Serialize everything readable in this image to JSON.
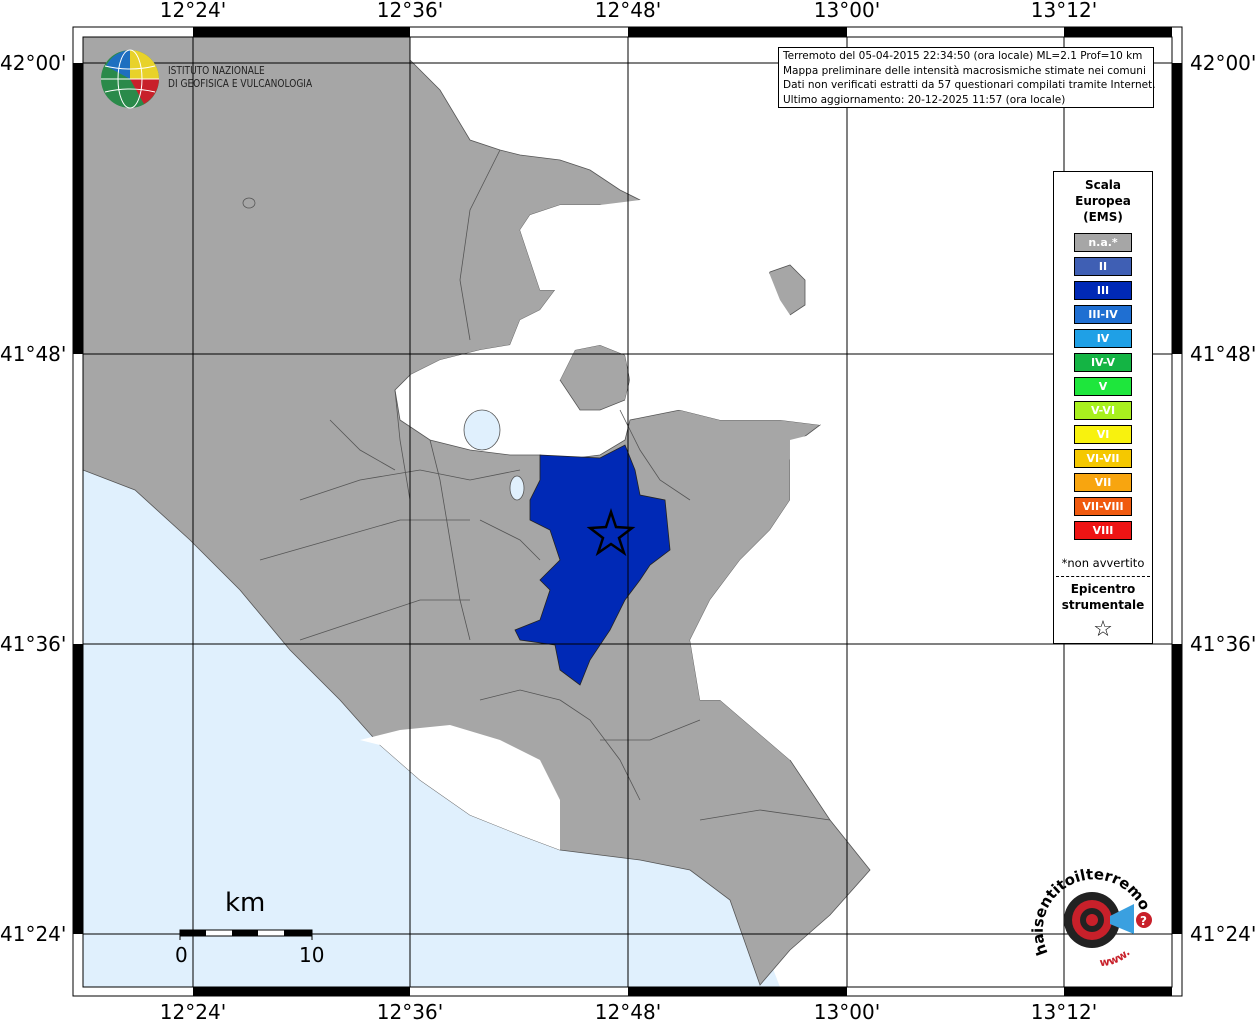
{
  "map": {
    "ticks_x": [
      "12°24'",
      "12°36'",
      "12°48'",
      "13°00'",
      "13°12'"
    ],
    "ticks_y": [
      "42°00'",
      "41°48'",
      "41°36'",
      "41°24'"
    ],
    "colors": {
      "land": "#a6a6a6",
      "sea": "#e0f0fd",
      "unsurveyed": "#ffffff",
      "felt_III": "#0029b6",
      "lake": "#e0f0fd",
      "borders": "#555555"
    }
  },
  "info": {
    "line1": "Terremoto del 05-04-2015 22:34:50 (ora locale) ML=2.1 Prof=10 km",
    "line2": "Mappa preliminare delle intensità macrosismiche stimate nei comuni",
    "line3": "Dati non verificati estratti da 57 questionari compilati tramite Internet.",
    "line4": "Ultimo aggiornamento: 20-12-2025 11:57 (ora locale)"
  },
  "institute": {
    "line1": "ISTITUTO NAZIONALE",
    "line2": "DI GEOFISICA E VULCANOLOGIA"
  },
  "legend": {
    "title1": "Scala",
    "title2": "Europea",
    "title3": "(EMS)",
    "items": [
      {
        "label": "n.a.*",
        "color": "#a6a6a6"
      },
      {
        "label": "II",
        "color": "#3f5fb4"
      },
      {
        "label": "III",
        "color": "#0029b6"
      },
      {
        "label": "III-IV",
        "color": "#1f6fd2"
      },
      {
        "label": "IV",
        "color": "#1fa0e6"
      },
      {
        "label": "IV-V",
        "color": "#14b444"
      },
      {
        "label": "V",
        "color": "#1ee63c"
      },
      {
        "label": "V-VI",
        "color": "#a8f01e"
      },
      {
        "label": "VI",
        "color": "#f8f20e"
      },
      {
        "label": "VI-VII",
        "color": "#f5c800"
      },
      {
        "label": "VII",
        "color": "#f8a50f"
      },
      {
        "label": "VII-VIII",
        "color": "#f05a0f"
      },
      {
        "label": "VIII",
        "color": "#ee1414"
      }
    ],
    "note": "*non avvertito",
    "epicenter1": "Epicentro",
    "epicenter2": "strumentale",
    "star": "☆"
  },
  "scale_bar": {
    "unit": "km",
    "min": "0",
    "max": "10"
  },
  "brand": {
    "text": "haisentitoilterremoto.it",
    "url": "www.",
    "question": "?"
  }
}
